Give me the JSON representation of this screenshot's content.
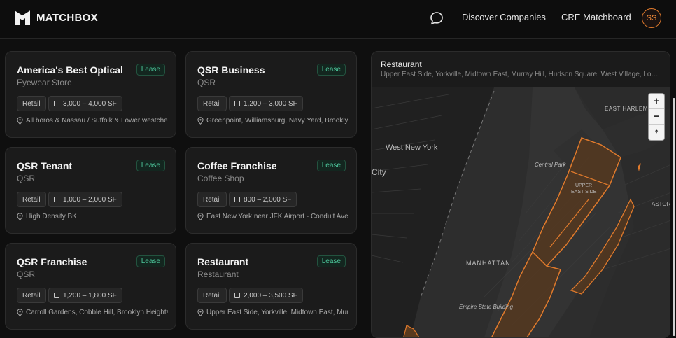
{
  "brand": {
    "name": "MATCHBOX"
  },
  "nav": {
    "messages_icon": "chat-bubble-icon",
    "discover_label": "Discover Companies",
    "cre_label": "CRE Matchboard",
    "avatar_initials": "SS"
  },
  "colors": {
    "accent": "#e07a2c",
    "lease_badge": "#4cc59a",
    "background": "#0f0f0f",
    "card": "#1b1b1b"
  },
  "cards": [
    {
      "title": "America's Best Optical",
      "subtitle": "Eyewear Store",
      "badge": "Lease",
      "type": "Retail",
      "size": "3,000 – 4,000 SF",
      "location": "All boros & Nassau / Suffolk & Lower westchester"
    },
    {
      "title": "QSR Business",
      "subtitle": "QSR",
      "badge": "Lease",
      "type": "Retail",
      "size": "1,200 – 3,000 SF",
      "location": "Greenpoint, Williamsburg, Navy Yard, Brooklyn Heights"
    },
    {
      "title": "QSR Tenant",
      "subtitle": "QSR",
      "badge": "Lease",
      "type": "Retail",
      "size": "1,000 – 2,000 SF",
      "location": "High Density BK"
    },
    {
      "title": "Coffee Franchise",
      "subtitle": "Coffee Shop",
      "badge": "Lease",
      "type": "Retail",
      "size": "800 – 2,000 SF",
      "location": "East New York near JFK Airport - Conduit Ave"
    },
    {
      "title": "QSR Franchise",
      "subtitle": "QSR",
      "badge": "Lease",
      "type": "Retail",
      "size": "1,200 – 1,800 SF",
      "location": "Carroll Gardens, Cobble Hill, Brooklyn Heights"
    },
    {
      "title": "Restaurant",
      "subtitle": "Restaurant",
      "badge": "Lease",
      "type": "Retail",
      "size": "2,000 – 3,500 SF",
      "location": "Upper East Side, Yorkville, Midtown East, Murray Hill"
    }
  ],
  "map_panel": {
    "title": "Restaurant",
    "subtitle": "Upper East Side, Yorkville, Midtown East, Murray Hill, Hudson Square, West Village, Low…",
    "zoom_in": "+",
    "zoom_out": "−",
    "compass": "⇡",
    "labels": {
      "east_harlem": "EAST HARLEM",
      "west_new_york": "West New York",
      "city": "City",
      "central_park": "Central Park",
      "upper_east_side_1": "UPPER",
      "upper_east_side_2": "EAST SIDE",
      "astoria": "ASTOR",
      "manhattan": "MANHATTAN",
      "empire_state": "Empire State Building"
    }
  }
}
